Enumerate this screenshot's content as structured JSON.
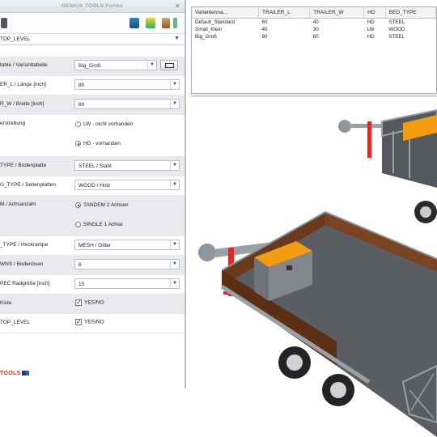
{
  "window": {
    "title": "GENIUS TOOLS Forms",
    "close_glyph": "×"
  },
  "level_select": {
    "value": "TOP_LEVEL"
  },
  "form": {
    "variant_table": {
      "label": "table / Varianttabelle",
      "value": "Big_Groß"
    },
    "trailer_l": {
      "label": "ER_L / Länge [inch]",
      "value": "80"
    },
    "trailer_w": {
      "label": "R_W / Breite [inch]",
      "value": "60"
    },
    "hd": {
      "label": "erstrebung",
      "options": [
        {
          "label": "LW - nicht vorhanden",
          "selected": false
        },
        {
          "label": "HD - vorhanden",
          "selected": true
        }
      ]
    },
    "bed_type": {
      "label": "TYPE / Bodenplatte",
      "value": "STEEL / Stahl"
    },
    "side_type": {
      "label": "G_TYPE / Seitenplatten",
      "value": "WOOD / Holz"
    },
    "axles": {
      "label": "M / Achsanzahl",
      "options": [
        {
          "label": "TANDEM 2 Achsen",
          "selected": true
        },
        {
          "label": "SINGLE 1 Achse",
          "selected": false
        }
      ]
    },
    "ramp_type": {
      "label": "_TYPE / Heckrampe",
      "value": "MESH / Gitter"
    },
    "tiedowns": {
      "label": "WNS / Bodenösen",
      "value": "6"
    },
    "wheel_spec": {
      "label": "PEC Radgröße [inch]",
      "value": "15"
    },
    "box": {
      "label": "Kiste",
      "check_label": "YES/NO",
      "checked": true
    },
    "top_level": {
      "label": "TOP_LEVEL",
      "check_label": "YES/NO",
      "checked": true
    }
  },
  "logo": {
    "text": "TOOLS"
  },
  "variant_grid": {
    "columns": [
      "Variantenna...",
      "TRAILER_L",
      "TRAILER_W",
      "HD",
      "BED_TYPE"
    ],
    "rows": [
      [
        "Default_Standard",
        "60",
        "40",
        "HD",
        "STEEL"
      ],
      [
        "Small_Klein",
        "40",
        "30",
        "LW",
        "WOOD"
      ],
      [
        "Big_Groß",
        "80",
        "60",
        "HD",
        "STEEL"
      ]
    ]
  },
  "colors": {
    "deck_wood": "#6b3a1c",
    "frame": "#8a8f96",
    "box": "#f39c12",
    "jack": "#d62c2c"
  }
}
